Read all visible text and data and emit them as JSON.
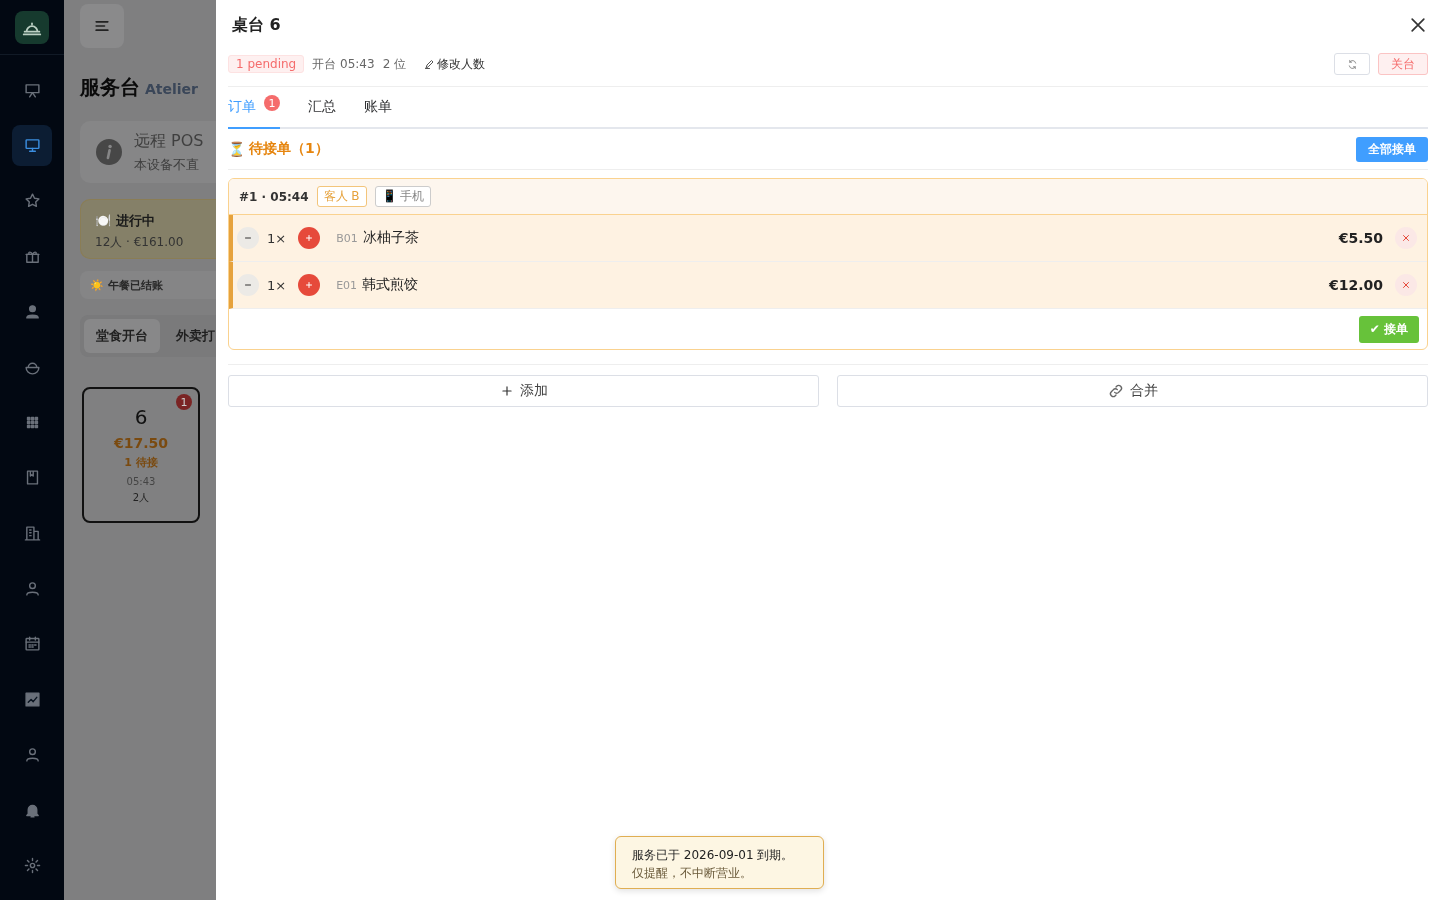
{
  "sidebar": {
    "items": [
      {
        "selected": false
      },
      {
        "selected": true
      },
      {
        "selected": false
      },
      {
        "selected": false
      },
      {
        "selected": false
      },
      {
        "selected": false
      },
      {
        "selected": false
      },
      {
        "selected": false
      },
      {
        "selected": false
      },
      {
        "selected": false
      },
      {
        "selected": false
      },
      {
        "selected": false
      },
      {
        "selected": false
      },
      {
        "selected": false
      },
      {
        "selected": false
      }
    ]
  },
  "background": {
    "title": "服务台",
    "subtitle": "Atelier",
    "notice": {
      "title": "远程 POS",
      "text": "本设备不直"
    },
    "status": {
      "emoji": "🍽️",
      "label": "进行中",
      "detail": "12人 · €161.00"
    },
    "meal": {
      "emoji": "☀️",
      "label": "午餐已结账"
    },
    "modes": [
      {
        "label": "堂食开台",
        "selected": true
      },
      {
        "label": "外卖打",
        "selected": false
      }
    ],
    "table": {
      "number": "6",
      "badge": "1",
      "amount": "€17.50",
      "pending": "1 待接",
      "time": "05:43",
      "guests": "2人"
    }
  },
  "drawer": {
    "title": "桌台 6",
    "status_badge": "1 pending",
    "opened": "开台 05:43",
    "seats": "2 位",
    "edit_guests": "修改人数",
    "close_table": "关台",
    "tabs": [
      {
        "label": "订单",
        "badge": "1",
        "selected": true
      },
      {
        "label": "汇总",
        "selected": false
      },
      {
        "label": "账单",
        "selected": false
      }
    ],
    "section": {
      "icon": "⏳",
      "title": "待接单（1）",
      "accept_all": "全部接单"
    },
    "orders": [
      {
        "header": "#1 · 05:44",
        "guest": "客人 B",
        "source_icon": "📱",
        "source": "手机",
        "accept": "✔ 接单",
        "items": [
          {
            "qty": "1×",
            "code": "B01",
            "name": "冰柚子茶",
            "price": "€5.50"
          },
          {
            "qty": "1×",
            "code": "E01",
            "name": "韩式煎饺",
            "price": "€12.00"
          }
        ]
      }
    ],
    "actions": [
      {
        "kind": "add",
        "label": "添加"
      },
      {
        "kind": "merge",
        "label": "合并"
      }
    ]
  },
  "toast": {
    "lines": [
      "服务已于 2026-09-01 到期。",
      "仅提醒，不中断营业。"
    ]
  }
}
